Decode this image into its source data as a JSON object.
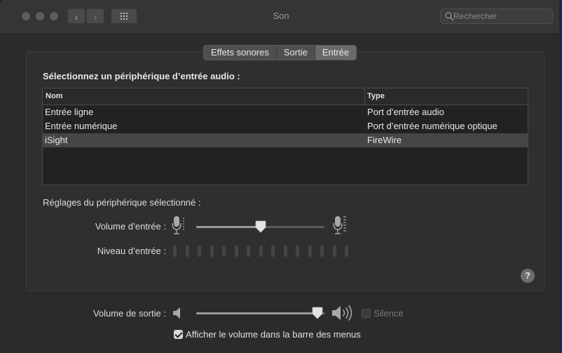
{
  "window": {
    "title": "Son"
  },
  "search": {
    "placeholder": "Rechercher"
  },
  "tabs": [
    {
      "label": "Effets sonores",
      "active": false
    },
    {
      "label": "Sortie",
      "active": false
    },
    {
      "label": "Entrée",
      "active": true
    }
  ],
  "input_section": {
    "title": "Sélectionnez un périphérique d’entrée audio :",
    "columns": [
      "Nom",
      "Type"
    ],
    "rows": [
      {
        "name": "Entrée ligne",
        "type": "Port d’entrée audio",
        "selected": false
      },
      {
        "name": "Entrée numérique",
        "type": "Port d’entrée numérique optique",
        "selected": false
      },
      {
        "name": "iSight",
        "type": "FireWire",
        "selected": true
      }
    ]
  },
  "device_settings": {
    "title": "Réglages du périphérique sélectionné :",
    "input_volume_label": "Volume d’entrée :",
    "input_volume": 0.5,
    "input_level_label": "Niveau d’entrée :",
    "input_level_segments": 15,
    "input_level_active": 0
  },
  "help_label": "?",
  "output": {
    "volume_label": "Volume de sortie :",
    "volume": 0.94,
    "mute_label": "Silence",
    "mute_checked": false,
    "show_in_menubar_label": "Afficher le volume dans la barre des menus",
    "show_in_menubar_checked": true
  }
}
